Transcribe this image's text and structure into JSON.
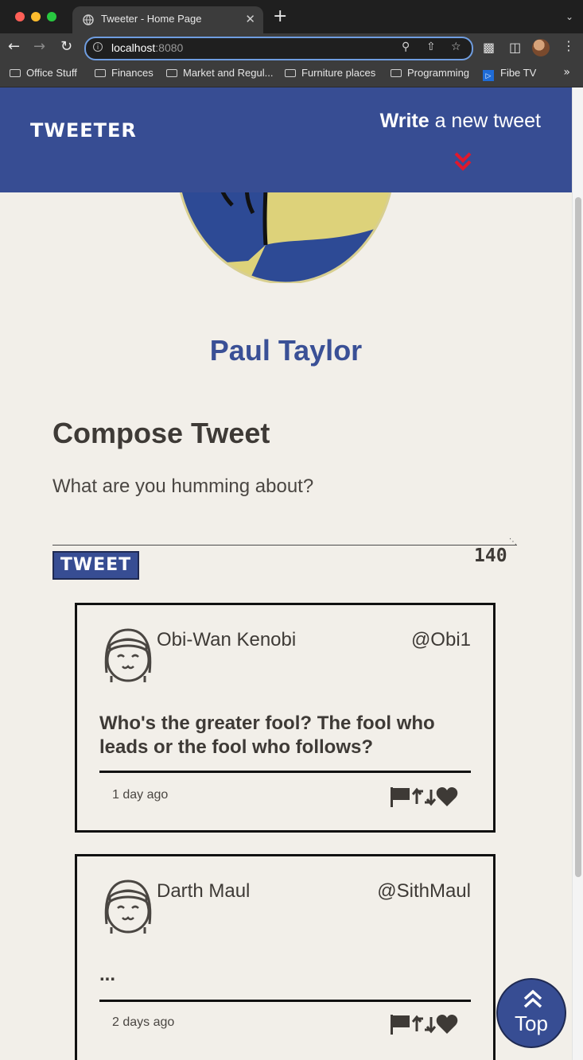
{
  "browser": {
    "tab_title": "Tweeter - Home Page",
    "tab_close": "✕",
    "new_tab": "+",
    "url_host": "localhost",
    "url_port": ":8080",
    "bookmarks": [
      "Office Stuff",
      "Finances",
      "Market and Regul...",
      "Furniture places",
      "Programming",
      "Fibe TV"
    ],
    "bookmarks_more": "»"
  },
  "header": {
    "logo": "TWEETER",
    "write_bold": "Write",
    "write_rest": " a new tweet"
  },
  "profile": {
    "name": "Paul Taylor"
  },
  "compose": {
    "title": "Compose Tweet",
    "placeholder": "What are you humming about?",
    "button_label": "TWEET",
    "counter": "140"
  },
  "tweets": [
    {
      "name": "Obi-Wan Kenobi",
      "handle": "@Obi1",
      "content": "Who's the greater fool? The fool who leads or the fool who follows?",
      "time": "1 day ago"
    },
    {
      "name": "Darth Maul",
      "handle": "@SithMaul",
      "content": "...",
      "time": "2 days ago"
    }
  ],
  "scroll_top": {
    "label": "Top"
  },
  "colors": {
    "header_blue": "#374d93",
    "background": "#f2efe9",
    "accent_red": "#e0182d",
    "text_dark": "#3e3a36"
  }
}
